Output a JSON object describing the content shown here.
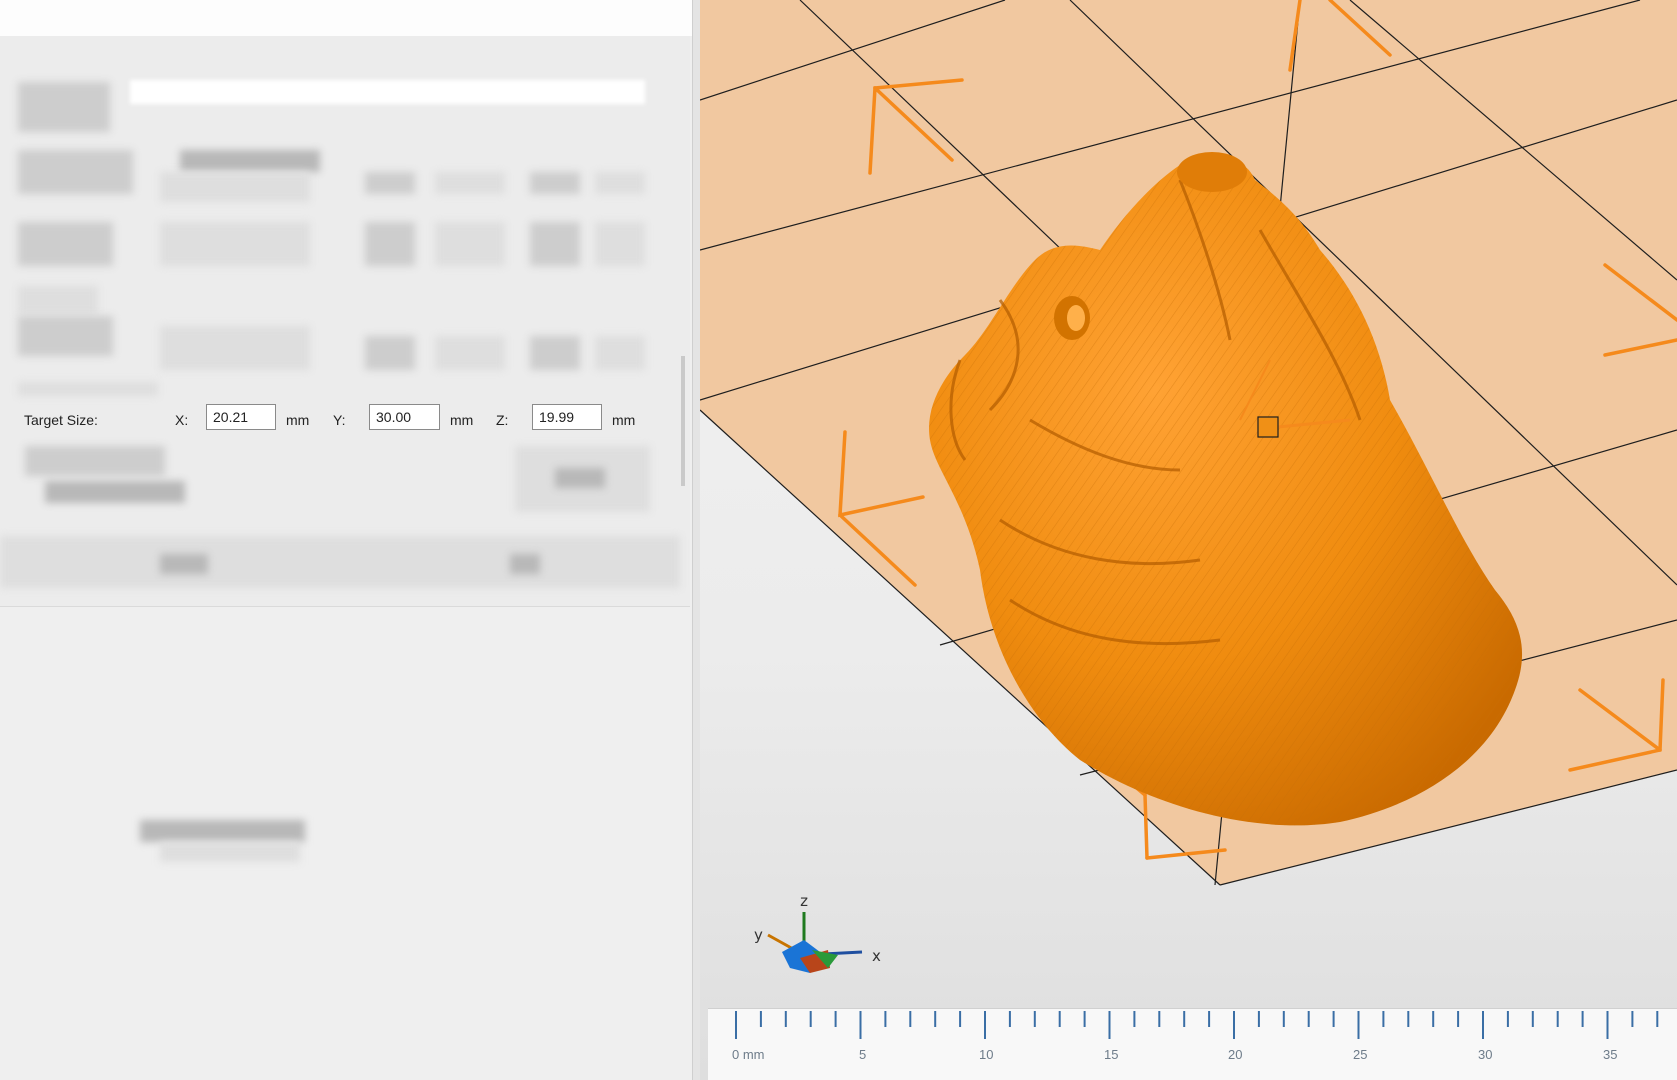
{
  "target_size": {
    "label": "Target Size:",
    "x_label": "X:",
    "x_value": "20.21",
    "y_label": "Y:",
    "y_value": "30.00",
    "z_label": "Z:",
    "z_value": "19.99",
    "unit": "mm"
  },
  "axis_indicator": {
    "x": "x",
    "y": "y",
    "z": "z"
  },
  "ruler": {
    "labels": [
      "0 mm",
      "5",
      "10",
      "15",
      "20",
      "25",
      "30",
      "35"
    ]
  },
  "colors": {
    "model": "#f08c0f",
    "bed": "#f1c8a0",
    "corner_markers": "#f58a1c",
    "ruler_ticks": "#3a6ea5"
  },
  "icons": [
    "axis-gizmo-icon"
  ]
}
